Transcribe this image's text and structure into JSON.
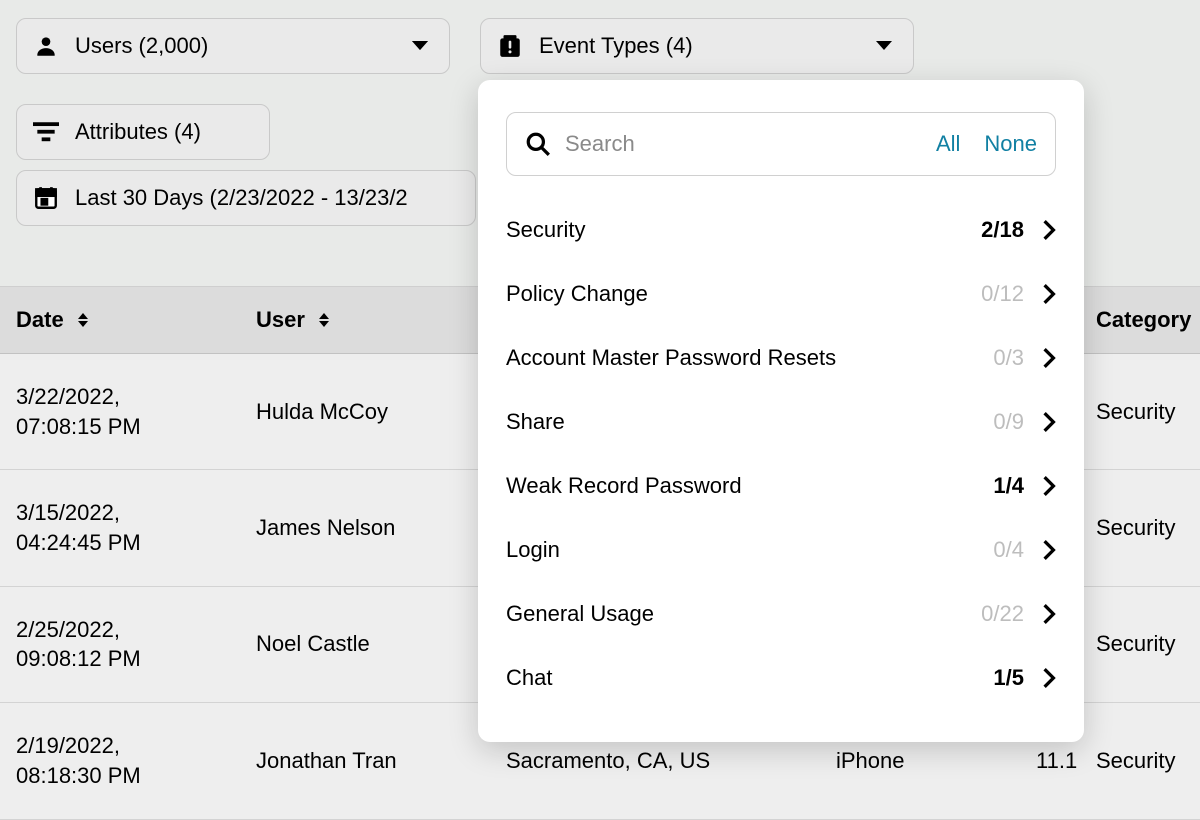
{
  "filters": {
    "users": "Users (2,000)",
    "event_types": "Event Types (4)",
    "attributes": "Attributes (4)",
    "date_range": "Last 30 Days (2/23/2022 - 13/23/2"
  },
  "dropdown": {
    "search_placeholder": "Search",
    "all": "All",
    "none": "None",
    "items": [
      {
        "name": "Security",
        "count": "2/18",
        "zero": false
      },
      {
        "name": "Policy Change",
        "count": "0/12",
        "zero": true
      },
      {
        "name": "Account Master Password Resets",
        "count": "0/3",
        "zero": true
      },
      {
        "name": "Share",
        "count": "0/9",
        "zero": true
      },
      {
        "name": "Weak Record Password",
        "count": "1/4",
        "zero": false
      },
      {
        "name": "Login",
        "count": "0/4",
        "zero": true
      },
      {
        "name": "General Usage",
        "count": "0/22",
        "zero": true
      },
      {
        "name": "Chat",
        "count": "1/5",
        "zero": false
      }
    ]
  },
  "table": {
    "headers": {
      "date": "Date",
      "user": "User",
      "category": "Category"
    },
    "rows": [
      {
        "date1": "3/22/2022,",
        "date2": "07:08:15 PM",
        "user": "Hulda McCoy",
        "loc": "",
        "device": "",
        "ver": "",
        "category": "Security"
      },
      {
        "date1": "3/15/2022,",
        "date2": "04:24:45 PM",
        "user": "James Nelson",
        "loc": "",
        "device": "",
        "ver": "",
        "category": "Security"
      },
      {
        "date1": "2/25/2022,",
        "date2": "09:08:12 PM",
        "user": "Noel Castle",
        "loc": "",
        "device": "",
        "ver": "",
        "category": "Security"
      },
      {
        "date1": "2/19/2022,",
        "date2": "08:18:30 PM",
        "user": "Jonathan Tran",
        "loc": "Sacramento, CA, US",
        "device": "iPhone",
        "ver": "11.1",
        "category": "Security"
      }
    ]
  }
}
